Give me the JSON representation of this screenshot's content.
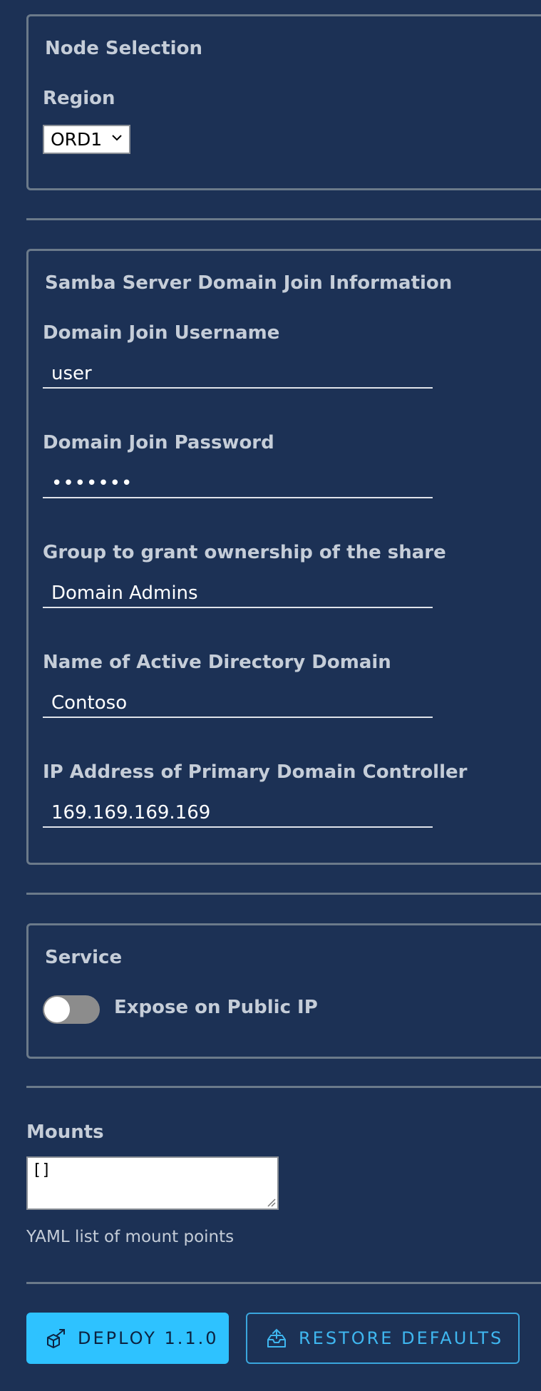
{
  "node_selection": {
    "legend": "Node Selection",
    "region_label": "Region",
    "region_value": "ORD1"
  },
  "samba": {
    "legend": "Samba Server Domain Join Information",
    "fields": [
      {
        "label": "Domain Join Username",
        "value": "user"
      },
      {
        "label": "Domain Join Password",
        "value": "•••••••"
      },
      {
        "label": "Group to grant ownership of the share",
        "value": "Domain Admins"
      },
      {
        "label": "Name of Active Directory Domain",
        "value": "Contoso"
      },
      {
        "label": "IP Address of Primary Domain Controller",
        "value": "169.169.169.169"
      }
    ]
  },
  "service": {
    "legend": "Service",
    "toggle_label": "Expose on Public IP",
    "toggle_on": false
  },
  "mounts": {
    "label": "Mounts",
    "value": "[]",
    "hint": "YAML list of mount points"
  },
  "actions": {
    "deploy_label": "DEPLOY 1.1.0",
    "restore_label": "RESTORE DEFAULTS"
  },
  "colors": {
    "background": "#1c3155",
    "primary": "#2ec2ff",
    "secondary_outline": "#3aa6dd"
  },
  "icons": {
    "region_select": "chevron-down-icon",
    "deploy": "deploy-cube-icon",
    "restore": "restore-tray-icon"
  }
}
